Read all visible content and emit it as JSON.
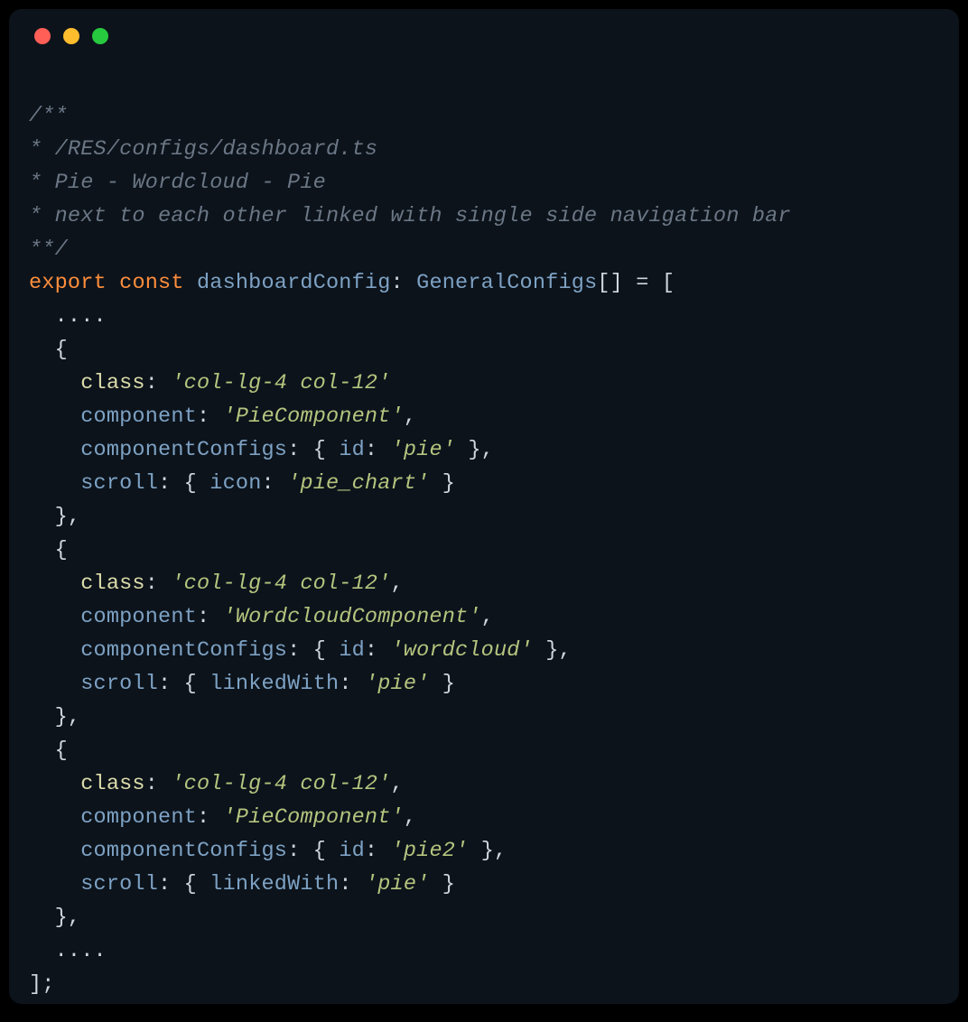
{
  "traffic_lights": {
    "red": "#ff5f56",
    "yellow": "#ffbd2e",
    "green": "#27c93f"
  },
  "comment": {
    "l1": "/**",
    "l2": "* /RES/configs/dashboard.ts",
    "l3": "* Pie - Wordcloud - Pie",
    "l4": "* next to each other linked with single side navigation bar",
    "l5": "**/"
  },
  "decl": {
    "export": "export",
    "const": "const",
    "name": "dashboardConfig",
    "type": "GeneralConfigs",
    "brackets": "[]",
    "eq_open": " = ["
  },
  "ellipsis": "....",
  "b1": {
    "class_k": "class",
    "class_v": "'col-lg-4 col-12'",
    "component_k": "component",
    "component_v": "'PieComponent'",
    "cfg_k": "componentConfigs",
    "id_k": "id",
    "id_v": "'pie'",
    "scroll_k": "scroll",
    "icon_k": "icon",
    "icon_v": "'pie_chart'"
  },
  "b2": {
    "class_k": "class",
    "class_v": "'col-lg-4 col-12'",
    "component_k": "component",
    "component_v": "'WordcloudComponent'",
    "cfg_k": "componentConfigs",
    "id_k": "id",
    "id_v": "'wordcloud'",
    "scroll_k": "scroll",
    "link_k": "linkedWith",
    "link_v": "'pie'"
  },
  "b3": {
    "class_k": "class",
    "class_v": "'col-lg-4 col-12'",
    "component_k": "component",
    "component_v": "'PieComponent'",
    "cfg_k": "componentConfigs",
    "id_k": "id",
    "id_v": "'pie2'",
    "scroll_k": "scroll",
    "link_k": "linkedWith",
    "link_v": "'pie'"
  },
  "sym": {
    "open_brace": "{",
    "close_brace_comma": "},",
    "colon": ":",
    "comma": ",",
    "arr_close": "];",
    "space": " "
  }
}
